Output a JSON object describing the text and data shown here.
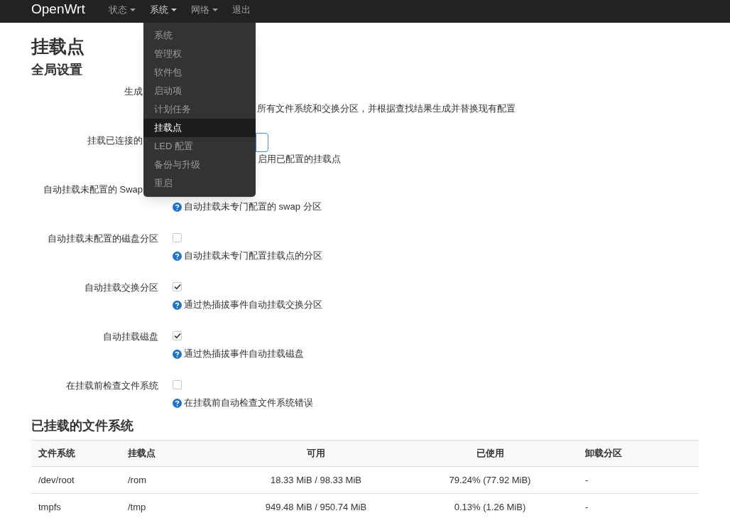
{
  "navbar": {
    "brand": "OpenWrt",
    "items": [
      {
        "label": "状态",
        "kind": "dropdown",
        "selected": false
      },
      {
        "label": "系统",
        "kind": "dropdown",
        "selected": true
      },
      {
        "label": "网络",
        "kind": "dropdown",
        "selected": false
      },
      {
        "label": "退出",
        "kind": "link",
        "selected": false
      }
    ]
  },
  "menu": {
    "items": [
      {
        "label": "系统",
        "selected": false
      },
      {
        "label": "管理权",
        "selected": false
      },
      {
        "label": "软件包",
        "selected": false
      },
      {
        "label": "启动项",
        "selected": false
      },
      {
        "label": "计划任务",
        "selected": false
      },
      {
        "label": "挂载点",
        "selected": true
      },
      {
        "label": "LED 配置",
        "selected": false
      },
      {
        "label": "备份与升级",
        "selected": false
      },
      {
        "label": "重启",
        "selected": false
      }
    ]
  },
  "page_title": "挂载点",
  "section_title": "全局设置",
  "settings": [
    {
      "label": "生成",
      "obscured": true,
      "kind": "none",
      "description": "所有文件系统和交换分区，并根据查找结果生成并替换现有配置"
    },
    {
      "label": "挂载已连接的",
      "obscured": true,
      "kind": "button",
      "description": "启用已配置的挂载点"
    },
    {
      "label": "自动挂载未配置的 Swap",
      "obscured": true,
      "kind": "none",
      "description": "自动挂载未专门配置的 swap 分区",
      "help": true
    },
    {
      "label": "自动挂载未配置的磁盘分区",
      "obscured": false,
      "kind": "checkbox",
      "checked": false,
      "description": "自动挂载未专门配置挂载点的分区",
      "help": true
    },
    {
      "label": "自动挂载交换分区",
      "obscured": false,
      "kind": "checkbox",
      "checked": true,
      "description": "通过热插拔事件自动挂载交换分区",
      "help": true
    },
    {
      "label": "自动挂载磁盘",
      "obscured": false,
      "kind": "checkbox",
      "checked": true,
      "description": "通过热插拔事件自动挂载磁盘",
      "help": true
    },
    {
      "label": "在挂载前检查文件系统",
      "obscured": false,
      "kind": "checkbox",
      "checked": false,
      "description": "在挂载前自动检查文件系统错误",
      "help": true
    }
  ],
  "mounted": {
    "title": "已挂载的文件系统",
    "columns": [
      "文件系统",
      "挂载点",
      "可用",
      "已使用",
      "卸载分区"
    ],
    "rows": [
      [
        "/dev/root",
        "/rom",
        "18.33 MiB / 98.33 MiB",
        "79.24% (77.92 MiB)",
        "-"
      ],
      [
        "tmpfs",
        "/tmp",
        "949.48 MiB / 950.74 MiB",
        "0.13% (1.26 MiB)",
        "-"
      ]
    ]
  }
}
